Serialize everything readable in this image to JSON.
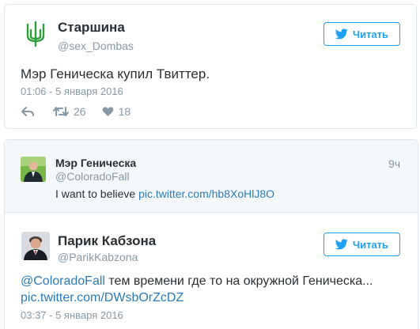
{
  "tweet1": {
    "name": "Старшина",
    "handle": "@sex_Dombas",
    "text": "Мэр Геническа купил Твиттер.",
    "time": "01:06 - 5 января 2016",
    "retweets": "26",
    "likes": "18",
    "follow_label": "Читать",
    "avatar_icon": "trident-emblem-icon",
    "accent_color": "#2e9e3a"
  },
  "quoted": {
    "name": "Мэр Геническа",
    "handle": "@ColoradoFall",
    "age": "9ч",
    "text_prefix": "I want to believe ",
    "link": "pic.twitter.com/hb8XoHlJ8O"
  },
  "tweet2": {
    "name": "Парик Кабзона",
    "handle": "@ParikKabzona",
    "mention": "@ColoradoFall",
    "text_rest": " тем времени где то на окружной Геническа...",
    "link": "pic.twitter.com/DWsbOrZcDZ",
    "time": "03:37 - 5 января 2016",
    "follow_label": "Читать"
  },
  "colors": {
    "link": "#2b7bb9",
    "twitter_blue": "#1da1f2",
    "muted": "#8899a6",
    "border": "#e1e8ed"
  }
}
